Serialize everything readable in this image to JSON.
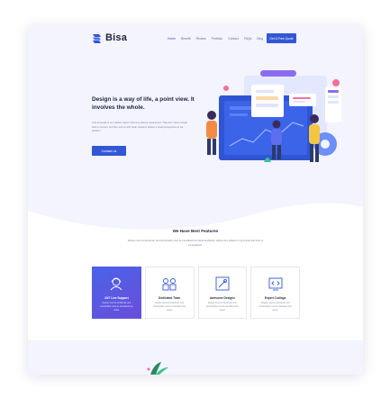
{
  "brand": {
    "name": "Bisa"
  },
  "nav": {
    "items": [
      "Home",
      "Benefit",
      "Review",
      "Portfolio",
      "Contact",
      "FAQs",
      "Blog"
    ],
    "active_index": 0,
    "cta_label": "Get A Free Quote"
  },
  "hero": {
    "title": "Design is a way of life, a point view. It involves the whole.",
    "description": "A lot of people in our industry haven't had very diverse experiences. They don't have enough dots to connect, and they end up with linear solutions without a broad perspective on the problem.",
    "button_label": "Contact Us"
  },
  "features": {
    "title": "We Have Best Features",
    "subtitle": "Design must be functional, and functionality must be translated into visual aesthetics, without any reliance on gimmicks that have to be explained.",
    "items": [
      {
        "title": "24/7 Live Support",
        "description": "Design must be functional, and functionality must be translated into visual.",
        "icon": "support-icon"
      },
      {
        "title": "Dedicated Team",
        "description": "Design must be functional, and functionality must be translated into visual.",
        "icon": "team-icon"
      },
      {
        "title": "Awesome Designs",
        "description": "Design must be functional, and functionality must be translated into visual.",
        "icon": "design-icon"
      },
      {
        "title": "Expert Codings",
        "description": "Design must be functional, and functionality must be translated into visual.",
        "icon": "code-icon"
      }
    ]
  },
  "colors": {
    "accent": "#3157d5",
    "hero_background": "#f3f4fd",
    "feature_active_gradient": [
      "#4a63e8",
      "#6a4ddb"
    ]
  }
}
